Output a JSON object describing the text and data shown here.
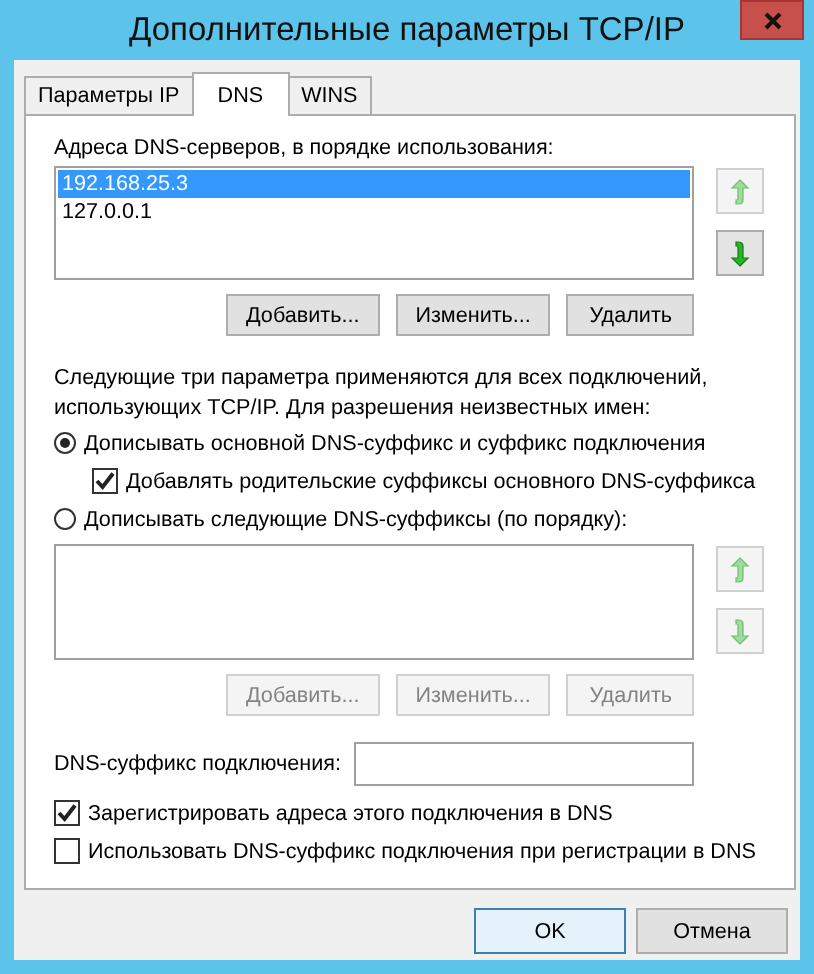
{
  "window": {
    "title": "Дополнительные параметры TCP/IP"
  },
  "tabs": [
    {
      "label": "Параметры IP",
      "selected": false
    },
    {
      "label": "DNS",
      "selected": true
    },
    {
      "label": "WINS",
      "selected": false
    }
  ],
  "dns_servers": {
    "label": "Адреса DNS-серверов, в порядке использования:",
    "items": [
      {
        "text": "192.168.25.3",
        "selected": true
      },
      {
        "text": "127.0.0.1",
        "selected": false
      }
    ],
    "move_up": {
      "disabled": true
    },
    "move_down": {
      "disabled": false
    },
    "buttons": [
      {
        "label": "Добавить...",
        "disabled": false
      },
      {
        "label": "Изменить...",
        "disabled": false
      },
      {
        "label": "Удалить",
        "disabled": false
      }
    ]
  },
  "description": "Следующие три параметра применяются для всех подключений, использующих TCP/IP. Для разрешения неизвестных имен:",
  "resolution_options": [
    {
      "kind": "radio",
      "label": "Дописывать основной DNS-суффикс и суффикс подключения",
      "selected": true,
      "children": [
        {
          "kind": "checkbox",
          "label": "Добавлять родительские суффиксы основного DNS-суффикса",
          "checked": true
        }
      ]
    },
    {
      "kind": "radio",
      "label": "Дописывать следующие DNS-суффиксы (по порядку):",
      "selected": false
    }
  ],
  "suffix_list": {
    "move_up": {
      "disabled": true
    },
    "move_down": {
      "disabled": true
    },
    "buttons": [
      {
        "label": "Добавить...",
        "disabled": true
      },
      {
        "label": "Изменить...",
        "disabled": true
      },
      {
        "label": "Удалить",
        "disabled": true
      }
    ]
  },
  "connection_suffix": {
    "label": "DNS-суффикс подключения:"
  },
  "checkboxes": [
    {
      "label": "Зарегистрировать адреса этого подключения в DNS",
      "checked": true
    },
    {
      "label": "Использовать DNS-суффикс подключения при регистрации в DNS",
      "checked": false
    }
  ],
  "footer_buttons": [
    {
      "label": "OK",
      "default": true
    },
    {
      "label": "Отмена",
      "default": false
    }
  ]
}
